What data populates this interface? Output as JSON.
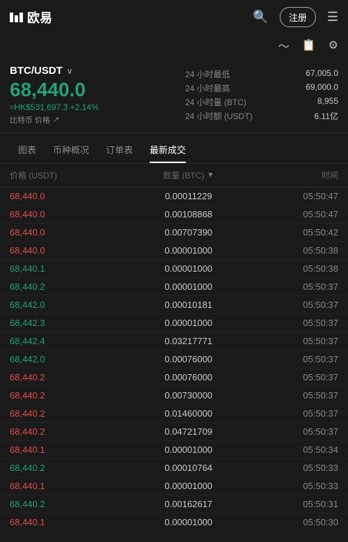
{
  "header": {
    "logo_text": "欧易",
    "register_label": "注册",
    "search_label": "搜索",
    "menu_label": "菜单"
  },
  "pair": {
    "name": "BTC/USDT",
    "main_price": "68,440.0",
    "hk_price": "≈HK$531,697.3",
    "change_pct": "+2.14%",
    "btc_label": "比特币 价格"
  },
  "stats": [
    {
      "label": "24 小时最低",
      "value": "67,005.0"
    },
    {
      "label": "24 小时最高",
      "value": "69,000.0"
    },
    {
      "label": "24 小时量 (BTC)",
      "value": "8,955"
    },
    {
      "label": "24 小时额 (USDT)",
      "value": "6.11亿"
    }
  ],
  "tabs": [
    {
      "id": "chart",
      "label": "图表"
    },
    {
      "id": "coins",
      "label": "币种概况"
    },
    {
      "id": "orders",
      "label": "订单表"
    },
    {
      "id": "trades",
      "label": "最新成交",
      "active": true
    }
  ],
  "table_header": {
    "price": "价格 (USDT)",
    "amount": "数量 (BTC)",
    "time": "时间"
  },
  "trades": [
    {
      "price": "68,440.0",
      "color": "red",
      "amount": "0.00011229",
      "time": "05:50:47"
    },
    {
      "price": "68,440.0",
      "color": "red",
      "amount": "0.00108868",
      "time": "05:50:47"
    },
    {
      "price": "68,440.0",
      "color": "red",
      "amount": "0.00707390",
      "time": "05:50:42"
    },
    {
      "price": "68,440.0",
      "color": "red",
      "amount": "0.00001000",
      "time": "05:50:38"
    },
    {
      "price": "68,440.1",
      "color": "green",
      "amount": "0.00001000",
      "time": "05:50:38"
    },
    {
      "price": "68,440.2",
      "color": "green",
      "amount": "0.00001000",
      "time": "05:50:37"
    },
    {
      "price": "68,442.0",
      "color": "green",
      "amount": "0.00010181",
      "time": "05:50:37"
    },
    {
      "price": "68,442.3",
      "color": "green",
      "amount": "0.00001000",
      "time": "05:50:37"
    },
    {
      "price": "68,442.4",
      "color": "green",
      "amount": "0.03217771",
      "time": "05:50:37"
    },
    {
      "price": "68,442.0",
      "color": "green",
      "amount": "0.00076000",
      "time": "05:50:37"
    },
    {
      "price": "68,440.2",
      "color": "red",
      "amount": "0.00076000",
      "time": "05:50:37"
    },
    {
      "price": "68,440.2",
      "color": "red",
      "amount": "0.00730000",
      "time": "05:50:37"
    },
    {
      "price": "68,440.2",
      "color": "red",
      "amount": "0.01460000",
      "time": "05:50:37"
    },
    {
      "price": "68,440.2",
      "color": "red",
      "amount": "0.04721709",
      "time": "05:50:37"
    },
    {
      "price": "68,440.1",
      "color": "red",
      "amount": "0.00001000",
      "time": "05:50:34"
    },
    {
      "price": "68,440.2",
      "color": "green",
      "amount": "0.00010764",
      "time": "05:50:33"
    },
    {
      "price": "68,440.1",
      "color": "red",
      "amount": "0.00001000",
      "time": "05:50:33"
    },
    {
      "price": "68,440.2",
      "color": "green",
      "amount": "0.00162617",
      "time": "05:50:31"
    },
    {
      "price": "68,440.1",
      "color": "red",
      "amount": "0.00001000",
      "time": "05:50:30"
    }
  ]
}
